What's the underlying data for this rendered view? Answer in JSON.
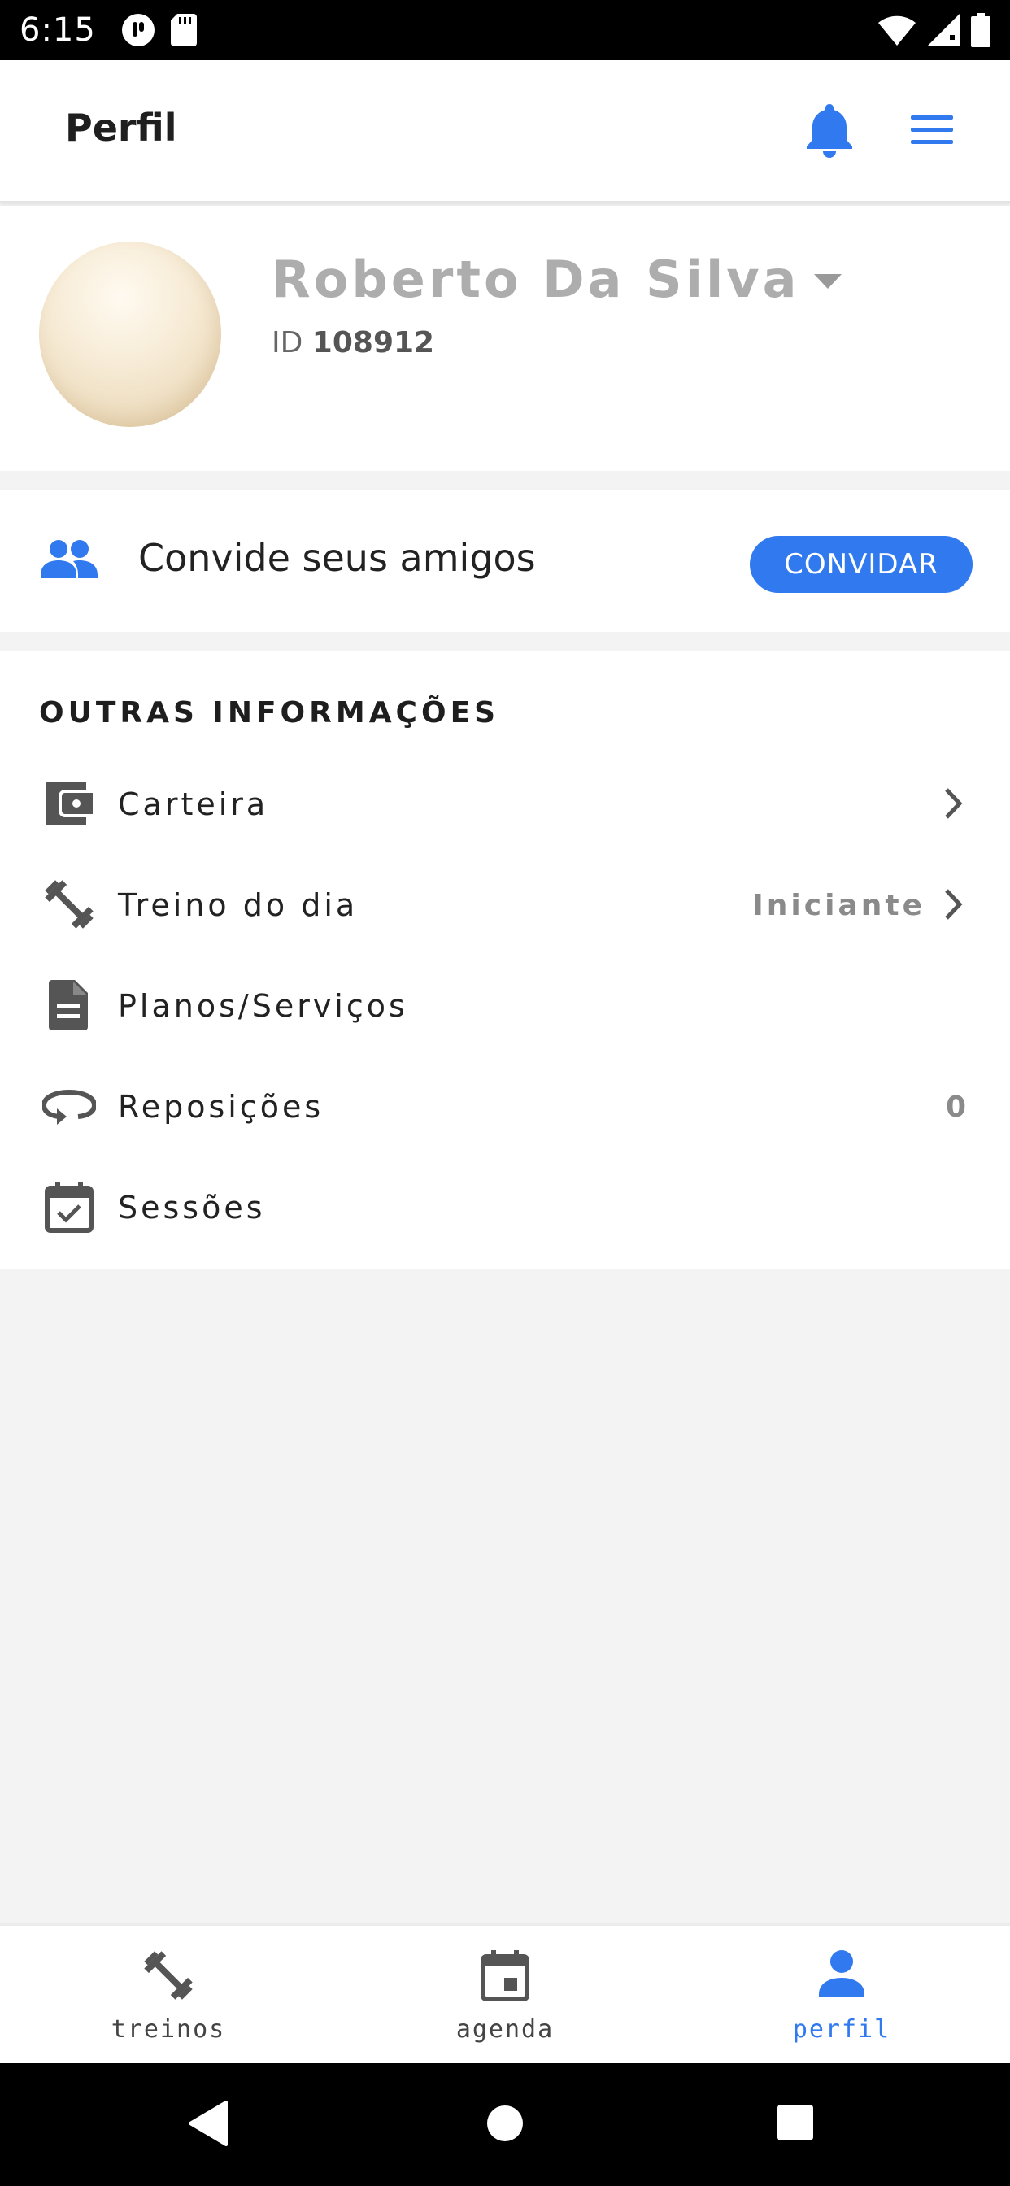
{
  "status_bar": {
    "time": "6:15",
    "left_icons": [
      "app-notification-icon",
      "sd-card-icon"
    ],
    "right_icons": [
      "wifi-icon",
      "signal-icon",
      "battery-icon"
    ]
  },
  "header": {
    "title": "Perfil",
    "bell_icon": "bell-icon",
    "menu_icon": "hamburger-menu-icon"
  },
  "profile": {
    "name": "Roberto Da Silva",
    "id_label": "ID",
    "id_value": "108912"
  },
  "invite": {
    "text": "Convide seus amigos",
    "button_label": "CONVIDAR"
  },
  "other_info": {
    "title": "OUTRAS INFORMAÇÕES",
    "items": [
      {
        "label": "Carteira",
        "value": "",
        "icon": "wallet-icon",
        "chevron": true
      },
      {
        "label": "Treino do dia",
        "value": "Iniciante",
        "icon": "dumbbell-icon",
        "chevron": true
      },
      {
        "label": "Planos/Serviços",
        "value": "",
        "icon": "document-icon",
        "chevron": false
      },
      {
        "label": "Reposições",
        "value": "0",
        "icon": "repeat-icon",
        "chevron": false
      },
      {
        "label": "Sessões",
        "value": "",
        "icon": "calendar-check-icon",
        "chevron": false
      }
    ]
  },
  "bottom_nav": {
    "items": [
      {
        "label": "treinos",
        "icon": "dumbbell-icon",
        "active": false
      },
      {
        "label": "agenda",
        "icon": "calendar-icon",
        "active": false
      },
      {
        "label": "perfil",
        "icon": "person-icon",
        "active": true
      }
    ]
  },
  "colors": {
    "accent": "#3079ee",
    "muted_text": "#adadad",
    "background": "#f3f3f3"
  }
}
